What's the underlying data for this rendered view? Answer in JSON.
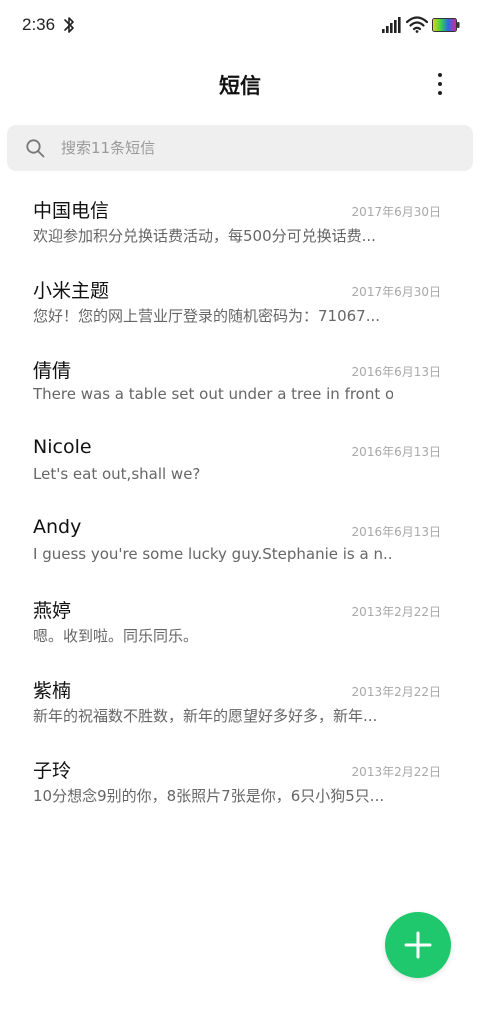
{
  "status_bar": {
    "time": "2:36",
    "icons": [
      "bluetooth-icon",
      "signal-icon",
      "wifi-icon",
      "battery-icon"
    ]
  },
  "header": {
    "title": "短信",
    "more_icon": "more-vertical-icon"
  },
  "search": {
    "placeholder": "搜索11条短信",
    "icon": "search-icon"
  },
  "messages": [
    {
      "name": "中国电信",
      "date": "2017年6月30日",
      "preview": "欢迎参加积分兑换话费活动，每500分可兑换话费..."
    },
    {
      "name": "小米主题",
      "date": "2017年6月30日",
      "preview": "您好！您的网上营业厅登录的随机密码为：71067..."
    },
    {
      "name": "倩倩",
      "date": "2016年6月13日",
      "preview": "There was a table set out under a tree in front o..."
    },
    {
      "name": "Nicole",
      "date": "2016年6月13日",
      "preview": "Let's eat out,shall we?"
    },
    {
      "name": "Andy",
      "date": "2016年6月13日",
      "preview": "I guess you're some lucky guy.Stephanie is a n..."
    },
    {
      "name": "燕婷",
      "date": "2013年2月22日",
      "preview": "嗯。收到啦。同乐同乐。"
    },
    {
      "name": "紫楠",
      "date": "2013年2月22日",
      "preview": "新年的祝福数不胜数，新年的愿望好多好多，新年..."
    },
    {
      "name": "子玲",
      "date": "2013年2月22日",
      "preview": "10分想念9别的你，8张照片7张是你，6只小狗5只..."
    }
  ],
  "fab": {
    "icon": "plus-icon",
    "color": "#1fc86c"
  },
  "colors": {
    "accent": "#1fc86c",
    "search_bg": "#efefef",
    "date_text": "#a8a8a8",
    "preview_text": "#666666"
  }
}
